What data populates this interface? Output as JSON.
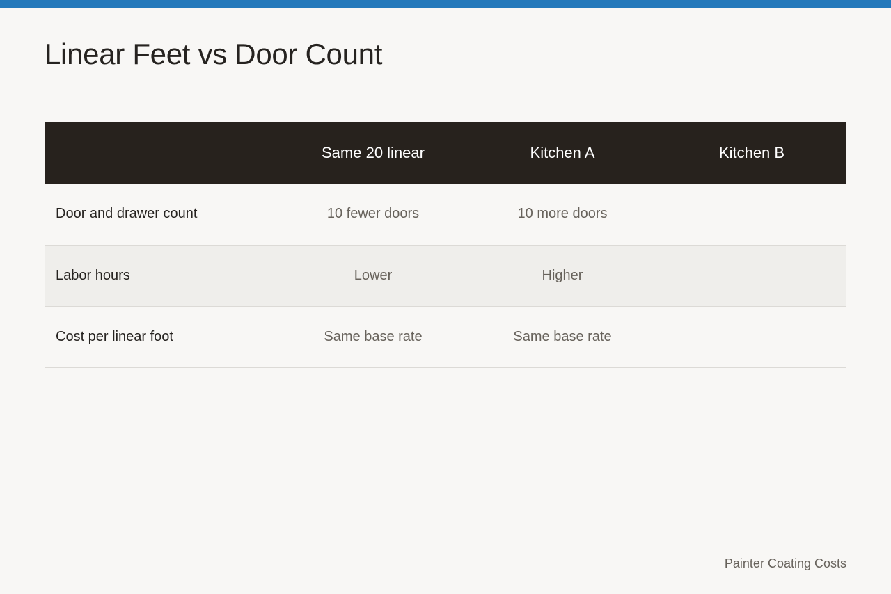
{
  "page": {
    "title": "Linear Feet vs Door Count",
    "footer": "Painter Coating Costs",
    "accent_color": "#2479bb",
    "header_color": "#27221d"
  },
  "table": {
    "headers": [
      "",
      "Same 20 linear",
      "Kitchen A",
      "Kitchen B"
    ],
    "rows": [
      {
        "label": "Door and drawer count",
        "cells": [
          "10 fewer doors",
          "10 more doors",
          ""
        ]
      },
      {
        "label": "Labor hours",
        "cells": [
          "Lower",
          "Higher",
          ""
        ]
      },
      {
        "label": "Cost per linear foot",
        "cells": [
          "Same base rate",
          "Same base rate",
          ""
        ]
      }
    ]
  }
}
